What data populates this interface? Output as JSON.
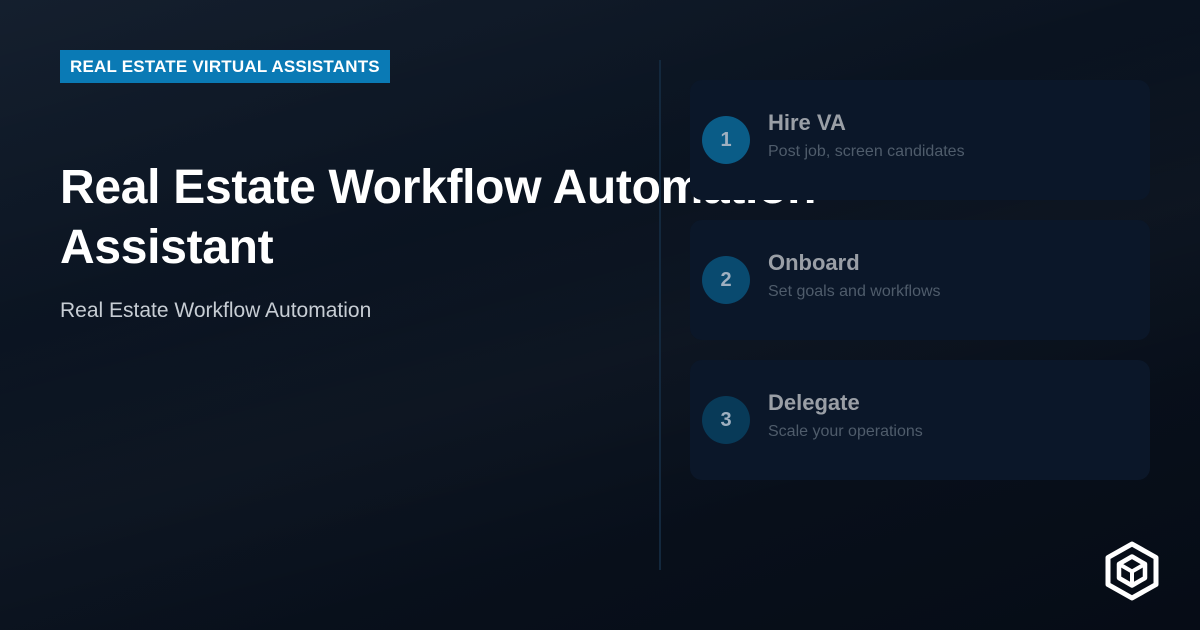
{
  "badge": {
    "label": "REAL ESTATE VIRTUAL ASSISTANTS"
  },
  "hero": {
    "title": "Real Estate Workflow Automation Assistant",
    "subtitle": "Real Estate Workflow Automation"
  },
  "steps": [
    {
      "number": "1",
      "title": "Hire VA",
      "description": "Post job, screen candidates"
    },
    {
      "number": "2",
      "title": "Onboard",
      "description": "Set goals and workflows"
    },
    {
      "number": "3",
      "title": "Delegate",
      "description": "Scale your operations"
    }
  ],
  "logo": {
    "icon": "cube-logo-icon"
  },
  "colors": {
    "accent": "#0a7ab5",
    "background": "#08111d",
    "card": "#0b1729"
  }
}
